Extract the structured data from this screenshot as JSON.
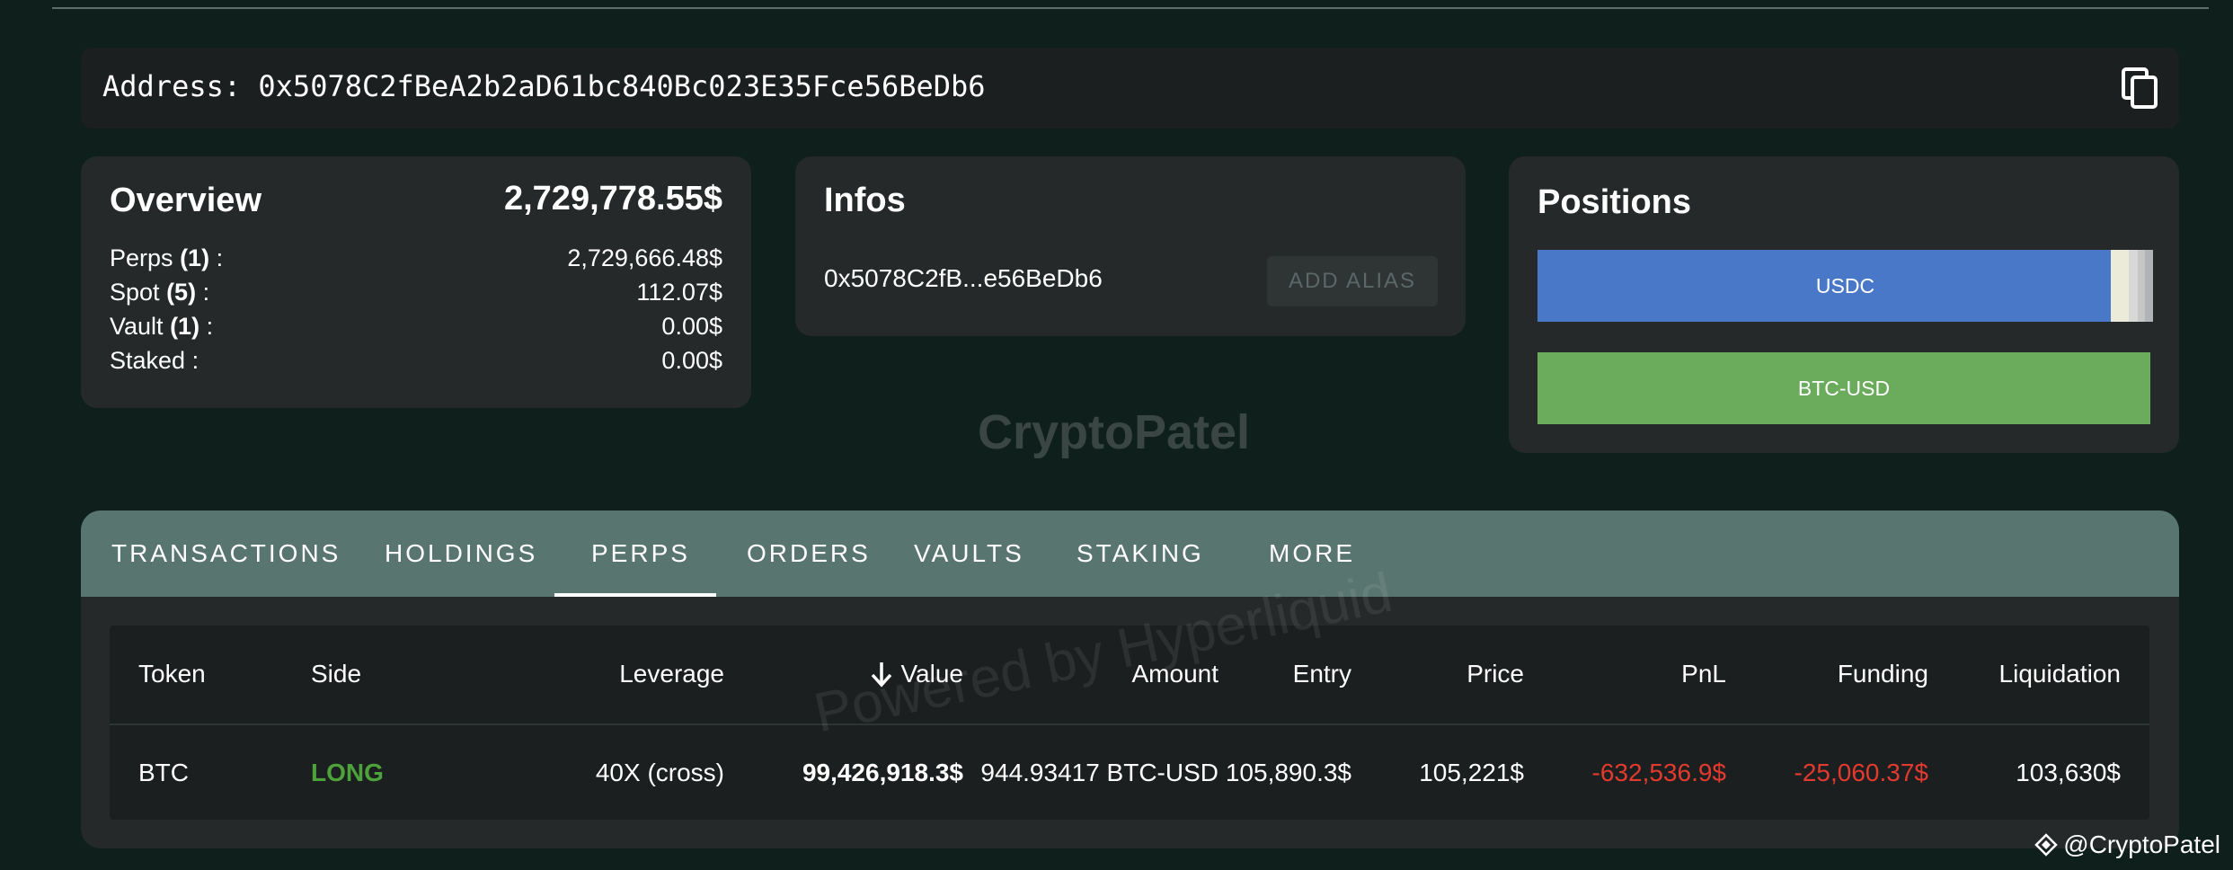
{
  "address": {
    "label": "Address: 0x5078C2fBeA2b2aD61bc840Bc023E35Fce56BeDb6"
  },
  "overview": {
    "title": "Overview",
    "total": "2,729,778.55$",
    "rows": [
      {
        "label": "Perps",
        "count": "(1)",
        "suffix": " :",
        "value": "2,729,666.48$"
      },
      {
        "label": "Spot",
        "count": "(5)",
        "suffix": " :",
        "value": "112.07$"
      },
      {
        "label": "Vault",
        "count": "(1)",
        "suffix": " :",
        "value": "0.00$"
      },
      {
        "label": "Staked",
        "count": "",
        "suffix": " :",
        "value": "0.00$"
      }
    ]
  },
  "infos": {
    "title": "Infos",
    "short_address": "0x5078C2fB...e56BeDb6",
    "alias_button": "ADD ALIAS"
  },
  "positions": {
    "title": "Positions",
    "bars": [
      {
        "label": "USDC",
        "color": "#4a78c8"
      },
      {
        "label": "BTC-USD",
        "color": "#6aab5c"
      }
    ]
  },
  "watermark": "CryptoPatel",
  "tabs": {
    "items": [
      "TRANSACTIONS",
      "HOLDINGS",
      "PERPS",
      "ORDERS",
      "VAULTS",
      "STAKING",
      "MORE"
    ],
    "active": "PERPS"
  },
  "table": {
    "headers": {
      "token": "Token",
      "side": "Side",
      "leverage": "Leverage",
      "value": "Value",
      "amount": "Amount",
      "entry": "Entry",
      "price": "Price",
      "pnl": "PnL",
      "funding": "Funding",
      "liquidation": "Liquidation"
    },
    "rows": [
      {
        "token": "BTC",
        "side": "LONG",
        "leverage": "40X (cross)",
        "value": "99,426,918.3$",
        "amount": "944.93417 BTC-USD",
        "entry": "105,890.3$",
        "price": "105,221$",
        "pnl": "-632,536.9$",
        "funding": "-25,060.37$",
        "liquidation": "103,630$"
      }
    ]
  },
  "powered_by": "Powered by Hyperliquid",
  "credit": "@CryptoPatel",
  "colors": {
    "long": "#4da23c",
    "negative": "#e33a2f",
    "tab_bar": "#587570",
    "background": "#0f1f1c"
  }
}
